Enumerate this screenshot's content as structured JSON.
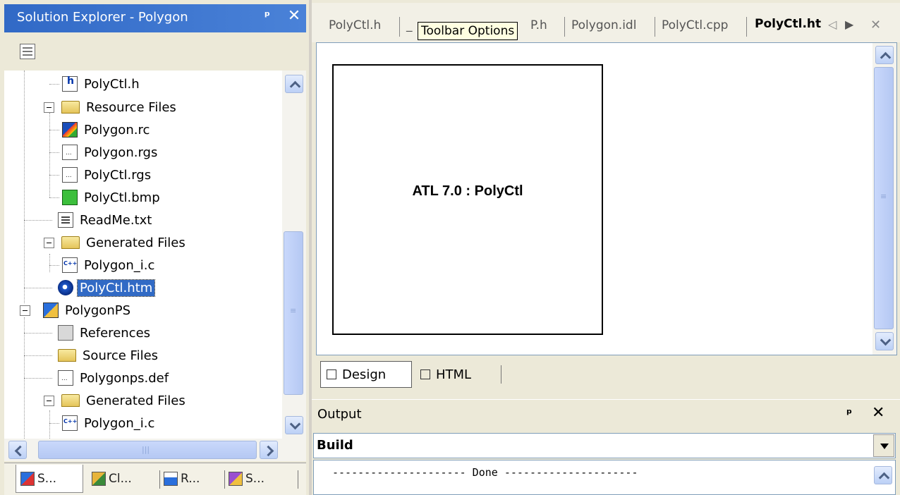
{
  "solution_explorer": {
    "title": "Solution Explorer - Polygon",
    "pin_glyph": "ꟼ",
    "close_glyph": "✕",
    "tree": [
      {
        "label": "PolyCtl.h",
        "icon": "header-file-icon"
      },
      {
        "label": "Resource Files",
        "icon": "folder-icon"
      },
      {
        "label": "Polygon.rc",
        "icon": "resource-file-icon"
      },
      {
        "label": "Polygon.rgs",
        "icon": "text-file-icon"
      },
      {
        "label": "PolyCtl.rgs",
        "icon": "text-file-icon"
      },
      {
        "label": "PolyCtl.bmp",
        "icon": "bitmap-file-icon"
      },
      {
        "label": "ReadMe.txt",
        "icon": "text-file-icon"
      },
      {
        "label": "Generated Files",
        "icon": "folder-icon"
      },
      {
        "label": "Polygon_i.c",
        "icon": "cpp-file-icon"
      },
      {
        "label": "PolyCtl.htm",
        "icon": "html-file-icon",
        "selected": true
      },
      {
        "label": "PolygonPS",
        "icon": "project-icon"
      },
      {
        "label": "References",
        "icon": "references-icon"
      },
      {
        "label": "Source Files",
        "icon": "folder-icon"
      },
      {
        "label": "Polygonps.def",
        "icon": "text-file-icon"
      },
      {
        "label": "Generated Files",
        "icon": "folder-icon"
      },
      {
        "label": "Polygon_i.c",
        "icon": "cpp-file-icon"
      }
    ],
    "bottom_tabs": [
      {
        "label": "S...",
        "icon": "solution-explorer-icon"
      },
      {
        "label": "Cl...",
        "icon": "class-view-icon"
      },
      {
        "label": "R...",
        "icon": "resource-view-icon"
      },
      {
        "label": "S...",
        "icon": "server-explorer-icon"
      }
    ]
  },
  "editor": {
    "tabs": [
      {
        "label": "PolyCtl.h"
      },
      {
        "label": "_"
      },
      {
        "label": "P.h"
      },
      {
        "label": "Polygon.idl"
      },
      {
        "label": "PolyCtl.cpp"
      },
      {
        "label": "PolyCtl.ht"
      }
    ],
    "tooltip": "Toolbar Options",
    "control_caption": "ATL 7.0 : PolyCtl",
    "view_tabs": [
      {
        "label": "Design",
        "active": true
      },
      {
        "label": "HTML",
        "active": false
      }
    ]
  },
  "output": {
    "title": "Output",
    "pane_selector": "Build",
    "lines": [
      "--------------------- Done ---------------------"
    ]
  },
  "colors": {
    "title_bar": "#3169c6",
    "selection": "#316ac5",
    "tooltip_bg": "#ffffe1"
  }
}
